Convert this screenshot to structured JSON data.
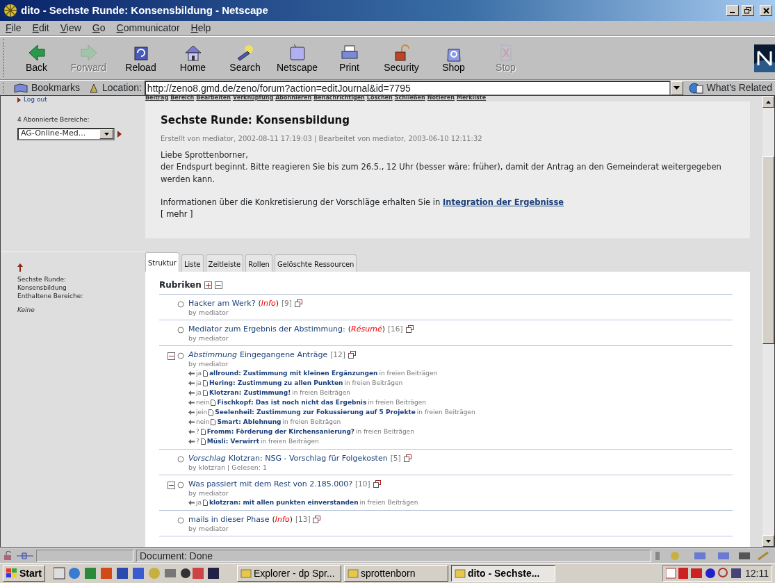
{
  "window": {
    "title": "dito - Sechste Runde: Konsensbildung - Netscape"
  },
  "menu": [
    "File",
    "Edit",
    "View",
    "Go",
    "Communicator",
    "Help"
  ],
  "toolbar": [
    {
      "label": "Back",
      "disabled": false
    },
    {
      "label": "Forward",
      "disabled": true
    },
    {
      "label": "Reload",
      "disabled": false
    },
    {
      "label": "Home",
      "disabled": false
    },
    {
      "label": "Search",
      "disabled": false
    },
    {
      "label": "Netscape",
      "disabled": false
    },
    {
      "label": "Print",
      "disabled": false
    },
    {
      "label": "Security",
      "disabled": false
    },
    {
      "label": "Shop",
      "disabled": false
    },
    {
      "label": "Stop",
      "disabled": true
    }
  ],
  "location_bar": {
    "bookmarks": "Bookmarks",
    "label": "Location:",
    "url": "http://zeno8.gmd.de/zeno/forum?action=editJournal&id=7795",
    "related": "What's Related"
  },
  "action_links": [
    "Beitrag",
    "Bereich",
    "Bearbeiten",
    "Verknüpfung",
    "Abonnieren",
    "Benachrichtigen",
    "Löschen",
    "Schließen",
    "Notieren",
    "Merkliste"
  ],
  "sidebar": {
    "logout": "Log out",
    "subscribed_label": "4 Abonnierte Bereiche:",
    "subscribed_value": "AG-Online-Med...",
    "section_title": "Sechste Runde: Konsensbildung",
    "contained_label": "Enthaltene Bereiche:",
    "contained_value": "Keine"
  },
  "journal": {
    "title": "Sechste Runde: Konsensbildung",
    "meta": "Erstellt von mediator, 2002-08-11 17:19:03 | Bearbeitet von mediator, 2003-06-10 12:11:32",
    "greeting": "Liebe Sprottenborner,",
    "body": "der Endspurt beginnt. Bitte reagieren Sie bis zum 26.5., 12 Uhr (besser wäre: früher), damit der Antrag an den Gemeinderat weitergegeben werden kann.",
    "info": "Informationen über die Konkretisierung der Vorschläge erhalten Sie in",
    "info_link": "Integration der Ergebnisse",
    "more": "[ mehr ]"
  },
  "tabs": [
    {
      "label": "Struktur",
      "selected": true
    },
    {
      "label": "Liste",
      "selected": false
    },
    {
      "label": "Zeitleiste",
      "selected": false
    },
    {
      "label": "Rollen",
      "selected": false
    },
    {
      "label": "Gelöschte Ressourcen",
      "selected": false
    }
  ],
  "rubriken": {
    "title": "Rubriken",
    "items": [
      {
        "title": "Hacker am Werk?",
        "tag": "(*Info*)",
        "count": "[9]",
        "byline": "by mediator"
      },
      {
        "title": "Mediator zum Ergebnis der Abstimmung:",
        "tag": "(*Résumé*)",
        "count": "[16]",
        "byline": "by mediator"
      },
      {
        "category": "Abstimmung",
        "title": "Eingegangene Anträge",
        "count": "[12]",
        "byline": "by mediator",
        "expanded": true,
        "replies": [
          {
            "vote": "ja",
            "title": "allround: Zustimmung mit kleinen Ergänzungen",
            "where": "in freien Beiträgen"
          },
          {
            "vote": "ja",
            "title": "Hering: Zustimmung zu allen Punkten",
            "where": "in freien Beiträgen"
          },
          {
            "vote": "ja",
            "title": "Klotzran: Zustimmung!",
            "where": "in freien Beiträgen"
          },
          {
            "vote": "nein",
            "title": "Fischkopf: Das ist noch nicht das Ergebnis",
            "where": "in freien Beiträgen"
          },
          {
            "vote": "jein",
            "title": "Seelenheil: Zustimmung zur Fokussierung auf 5 Projekte",
            "where": "in freien Beiträgen"
          },
          {
            "vote": "nein",
            "title": "Smart: Ablehnung",
            "where": "in freien Beiträgen"
          },
          {
            "vote": "?",
            "title": "Fromm: Förderung der Kirchensanierung?",
            "where": "in freien Beiträgen"
          },
          {
            "vote": "?",
            "title": "Müsli: Verwirrt",
            "where": "in freien Beiträgen"
          }
        ]
      },
      {
        "category": "Vorschlag",
        "title": "Klotzran: NSG - Vorschlag für Folgekosten",
        "count": "[5]",
        "byline": "by klotzran | Gelesen: 1"
      },
      {
        "title": "Was passiert mit dem Rest von 2.185.000?",
        "count": "[10]",
        "byline": "by mediator",
        "expanded": true,
        "replies": [
          {
            "vote": "ja",
            "title": "klotzran: mit allen punkten einverstanden",
            "where": "in freien Beiträgen"
          }
        ]
      },
      {
        "title": "mails in dieser Phase",
        "tag": "(*Info*)",
        "count": "[13]",
        "byline": "by mediator"
      }
    ]
  },
  "status_bar": {
    "text": "Document: Done"
  },
  "taskbar": {
    "start": "Start",
    "tasks": [
      {
        "label": "Explorer - dp Spr...",
        "selected": false
      },
      {
        "label": "sprottenborn",
        "selected": false
      },
      {
        "label": "dito - Sechste...",
        "selected": true
      }
    ],
    "clock": "12:11"
  }
}
